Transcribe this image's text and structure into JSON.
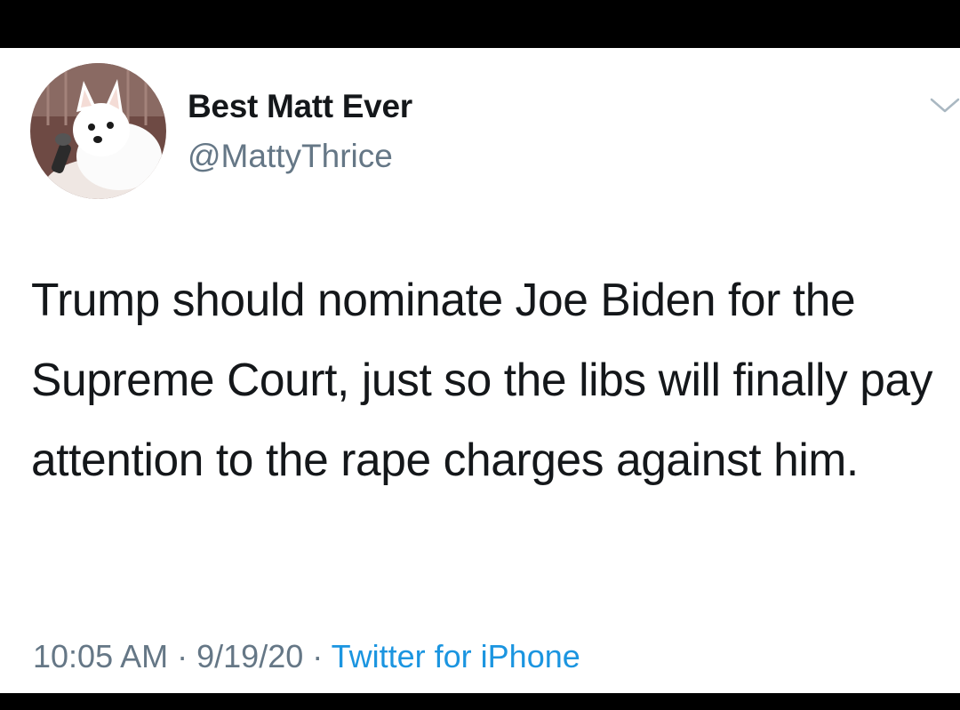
{
  "author": {
    "display_name": "Best Matt Ever",
    "handle": "@MattyThrice",
    "avatar_icon": "white-dog-avatar"
  },
  "tweet": {
    "text": "Trump should nominate Joe Biden for the Supreme Court, just so the libs will finally pay attention to the rape charges against him."
  },
  "meta": {
    "time": "10:05 AM",
    "separator": "·",
    "date": "9/19/20",
    "source": "Twitter for iPhone"
  },
  "colors": {
    "text": "#14171a",
    "secondary": "#657786",
    "link": "#1b95e0",
    "background": "#ffffff",
    "frame": "#000000"
  },
  "icons": {
    "menu": "chevron-down-icon"
  }
}
